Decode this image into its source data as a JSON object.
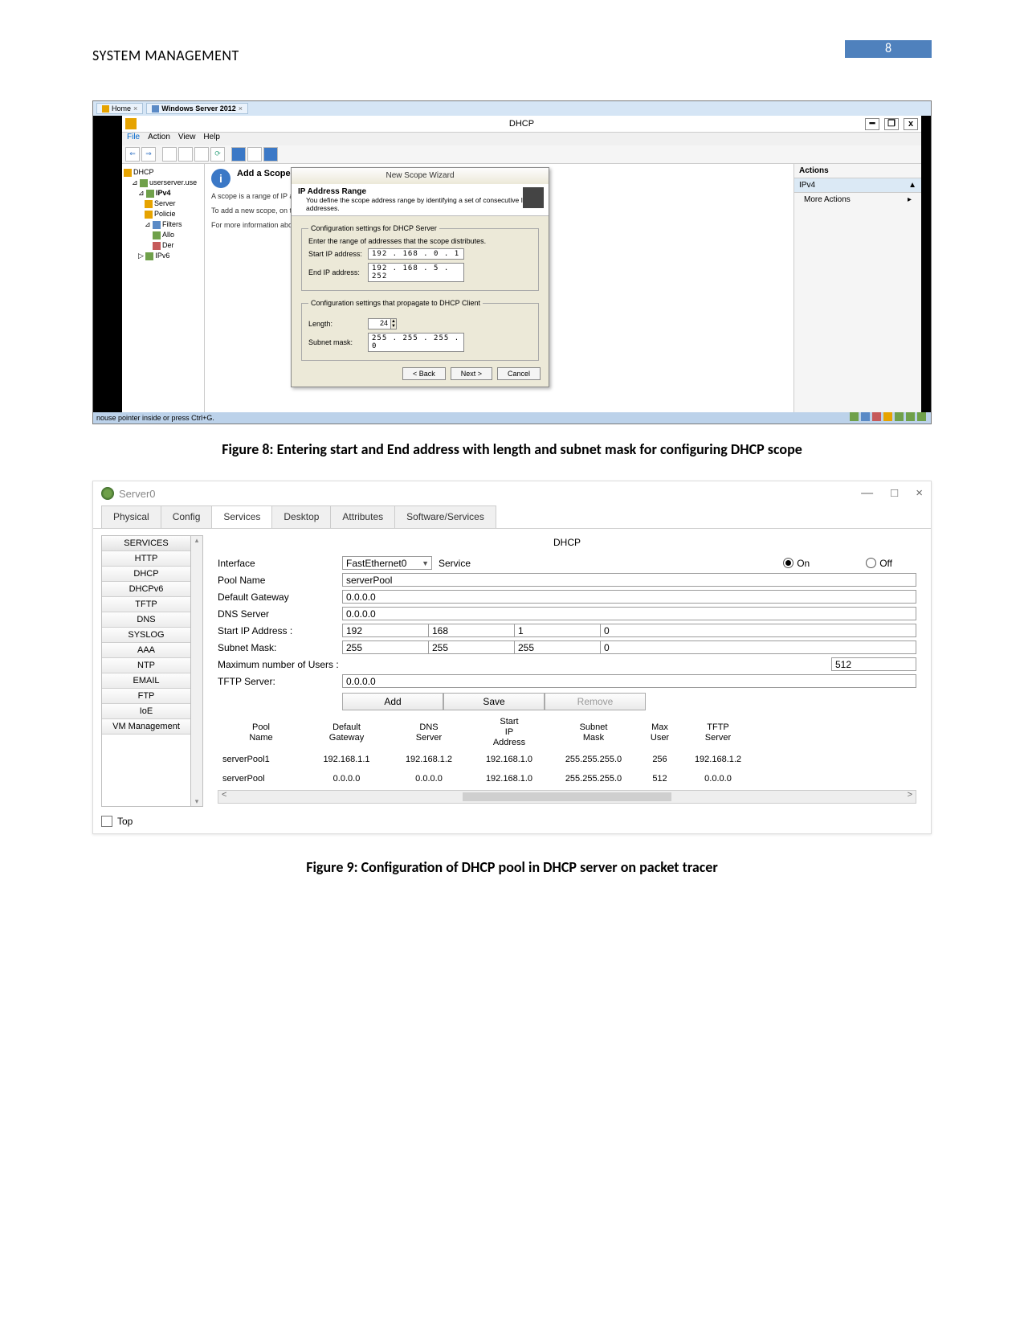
{
  "document": {
    "title": "SYSTEM MANAGEMENT",
    "page_number": "8",
    "caption_fig8": "Figure 8: Entering start and End address with length and subnet mask for configuring DHCP scope",
    "caption_fig9": "Figure 9: Configuration of DHCP pool in DHCP server on packet tracer"
  },
  "fig8": {
    "browser_tabs": {
      "home": "Home",
      "vm": "Windows Server 2012"
    },
    "window_title": "DHCP",
    "menu": [
      "File",
      "Action",
      "View",
      "Help"
    ],
    "tree": {
      "root": "DHCP",
      "server": "userserver.use",
      "ipv4": "IPv4",
      "nodes": [
        "Server",
        "Policie",
        "Filters",
        "Allo",
        "Der"
      ],
      "ipv6": "IPv6"
    },
    "scope_header": "Add a Scope",
    "scope_desc1": "A scope is a range of IP addresses and configure a scope before d",
    "scope_desc2": "To add a new scope, on the Act",
    "scope_desc3": "For more information about set",
    "actions": {
      "title": "Actions",
      "row": "IPv4",
      "more": "More Actions"
    },
    "wizard": {
      "title": "New Scope Wizard",
      "heading": "IP Address Range",
      "sub": "You define the scope address range by identifying a set of consecutive IP addresses.",
      "fs1_legend": "Configuration settings for DHCP Server",
      "fs1_hint": "Enter the range of addresses that the scope distributes.",
      "start_label": "Start IP address:",
      "start_value": "192 . 168 .  0  .  1",
      "end_label": "End IP address:",
      "end_value": "192 . 168 .  5  . 252",
      "fs2_legend": "Configuration settings that propagate to DHCP Client",
      "length_label": "Length:",
      "length_value": "24",
      "mask_label": "Subnet mask:",
      "mask_value": "255 . 255 . 255 .  0",
      "btn_back": "< Back",
      "btn_next": "Next >",
      "btn_cancel": "Cancel"
    },
    "status": "nouse pointer inside or press Ctrl+G."
  },
  "fig9": {
    "window_title": "Server0",
    "tabs": [
      "Physical",
      "Config",
      "Services",
      "Desktop",
      "Attributes",
      "Software/Services"
    ],
    "active_tab_index": 2,
    "sidebar": [
      "SERVICES",
      "HTTP",
      "DHCP",
      "DHCPv6",
      "TFTP",
      "DNS",
      "SYSLOG",
      "AAA",
      "NTP",
      "EMAIL",
      "FTP",
      "IoE",
      "VM Management"
    ],
    "form": {
      "title": "DHCP",
      "interface_label": "Interface",
      "interface_value": "FastEthernet0",
      "service_label": "Service",
      "on_label": "On",
      "off_label": "Off",
      "service_on": true,
      "pool_name_label": "Pool Name",
      "pool_name_value": "serverPool",
      "gateway_label": "Default Gateway",
      "gateway_value": "0.0.0.0",
      "dns_label": "DNS Server",
      "dns_value": "0.0.0.0",
      "start_label": "Start IP Address :",
      "start_oct": [
        "192",
        "168",
        "1",
        "0"
      ],
      "mask_label": "Subnet Mask:",
      "mask_oct": [
        "255",
        "255",
        "255",
        "0"
      ],
      "max_label": "Maximum number of Users :",
      "max_value": "512",
      "tftp_label": "TFTP Server:",
      "tftp_value": "0.0.0.0",
      "btn_add": "Add",
      "btn_save": "Save",
      "btn_remove": "Remove",
      "headers": [
        "Pool\nName",
        "Default\nGateway",
        "DNS\nServer",
        "Start\nIP\nAddress",
        "Subnet\nMask",
        "Max\nUser",
        "TFTP\nServer"
      ],
      "rows": [
        [
          "serverPool1",
          "192.168.1.1",
          "192.168.1.2",
          "192.168.1.0",
          "255.255.255.0",
          "256",
          "192.168.1.2"
        ],
        [
          "serverPool",
          "0.0.0.0",
          "0.0.0.0",
          "192.168.1.0",
          "255.255.255.0",
          "512",
          "0.0.0.0"
        ]
      ]
    },
    "footer_top": "Top"
  }
}
